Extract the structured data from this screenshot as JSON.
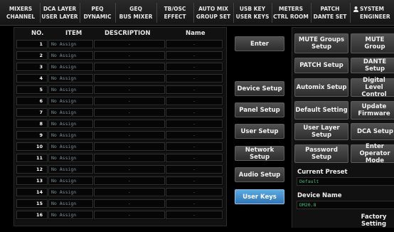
{
  "tabs": [
    {
      "line1": "MIXERS",
      "line2": "CHANNEL"
    },
    {
      "line1": "DCA LAYER",
      "line2": "USER LAYER"
    },
    {
      "line1": "PEQ",
      "line2": "DYNAMIC"
    },
    {
      "line1": "GEQ",
      "line2": "BUS MIXER"
    },
    {
      "line1": "TB/OSC",
      "line2": "EFFECT"
    },
    {
      "line1": "AUTO MIX",
      "line2": "GROUP SET"
    },
    {
      "line1": "USB KEY",
      "line2": "USER KEYS"
    },
    {
      "line1": "METERS",
      "line2": "CTRL ROOM"
    },
    {
      "line1": "PATCH",
      "line2": "DANTE SET"
    },
    {
      "line1": "SYSTEM",
      "line2": "ENGINEER"
    }
  ],
  "table": {
    "headers": {
      "no": "NO.",
      "item": "ITEM",
      "description": "DESCRIPTION",
      "name": "Name"
    },
    "rows": [
      {
        "no": "1",
        "item": "No Assign",
        "description": "-",
        "name": "-"
      },
      {
        "no": "2",
        "item": "No Assign",
        "description": "-",
        "name": "-"
      },
      {
        "no": "3",
        "item": "No Assign",
        "description": "-",
        "name": "-"
      },
      {
        "no": "4",
        "item": "No Assign",
        "description": "-",
        "name": "-"
      },
      {
        "no": "5",
        "item": "No Assign",
        "description": "-",
        "name": "-"
      },
      {
        "no": "6",
        "item": "No Assign",
        "description": "-",
        "name": "-"
      },
      {
        "no": "7",
        "item": "No Assign",
        "description": "-",
        "name": "-"
      },
      {
        "no": "8",
        "item": "No Assign",
        "description": "-",
        "name": "-"
      },
      {
        "no": "9",
        "item": "No Assign",
        "description": "-",
        "name": "-"
      },
      {
        "no": "10",
        "item": "No Assign",
        "description": "-",
        "name": "-"
      },
      {
        "no": "11",
        "item": "No Assign",
        "description": "-",
        "name": "-"
      },
      {
        "no": "12",
        "item": "No Assign",
        "description": "-",
        "name": "-"
      },
      {
        "no": "13",
        "item": "No Assign",
        "description": "-",
        "name": "-"
      },
      {
        "no": "14",
        "item": "No Assign",
        "description": "-",
        "name": "-"
      },
      {
        "no": "15",
        "item": "No Assign",
        "description": "-",
        "name": "-"
      },
      {
        "no": "16",
        "item": "No Assign",
        "description": "-",
        "name": "-"
      }
    ]
  },
  "mid_buttons": {
    "enter": "Enter",
    "device_setup": "Device Setup",
    "panel_setup": "Panel Setup",
    "user_setup": "User Setup",
    "network_setup": "Network Setup",
    "audio_setup": "Audio Setup",
    "user_keys": "User Keys"
  },
  "right_buttons": {
    "mute_groups_setup": "MUTE Groups Setup",
    "mute_group": "MUTE Group",
    "patch_setup": "PATCH Setup",
    "dante_setup": "DANTE Setup",
    "automix_setup": "Automix Setup",
    "digital_level_control": "Digital Level Control",
    "default_setting": "Default Setting",
    "update_firmware": "Update Firmware",
    "user_layer_setup": "User Layer Setup",
    "dca_setup": "DCA Setup",
    "password_setup": "Password Setup",
    "enter_operator_mode": "Enter Operator Mode",
    "factory_setting": "Factory Setting"
  },
  "current_preset": {
    "label": "Current Preset",
    "value": "Default"
  },
  "device_name": {
    "label": "Device Name",
    "value": "DM20.8"
  },
  "icons": {
    "system_tab": "user-icon"
  },
  "colors": {
    "active_button": "#3a8fd6",
    "field_text": "#3bc07a",
    "item_text": "#7f8f95"
  }
}
